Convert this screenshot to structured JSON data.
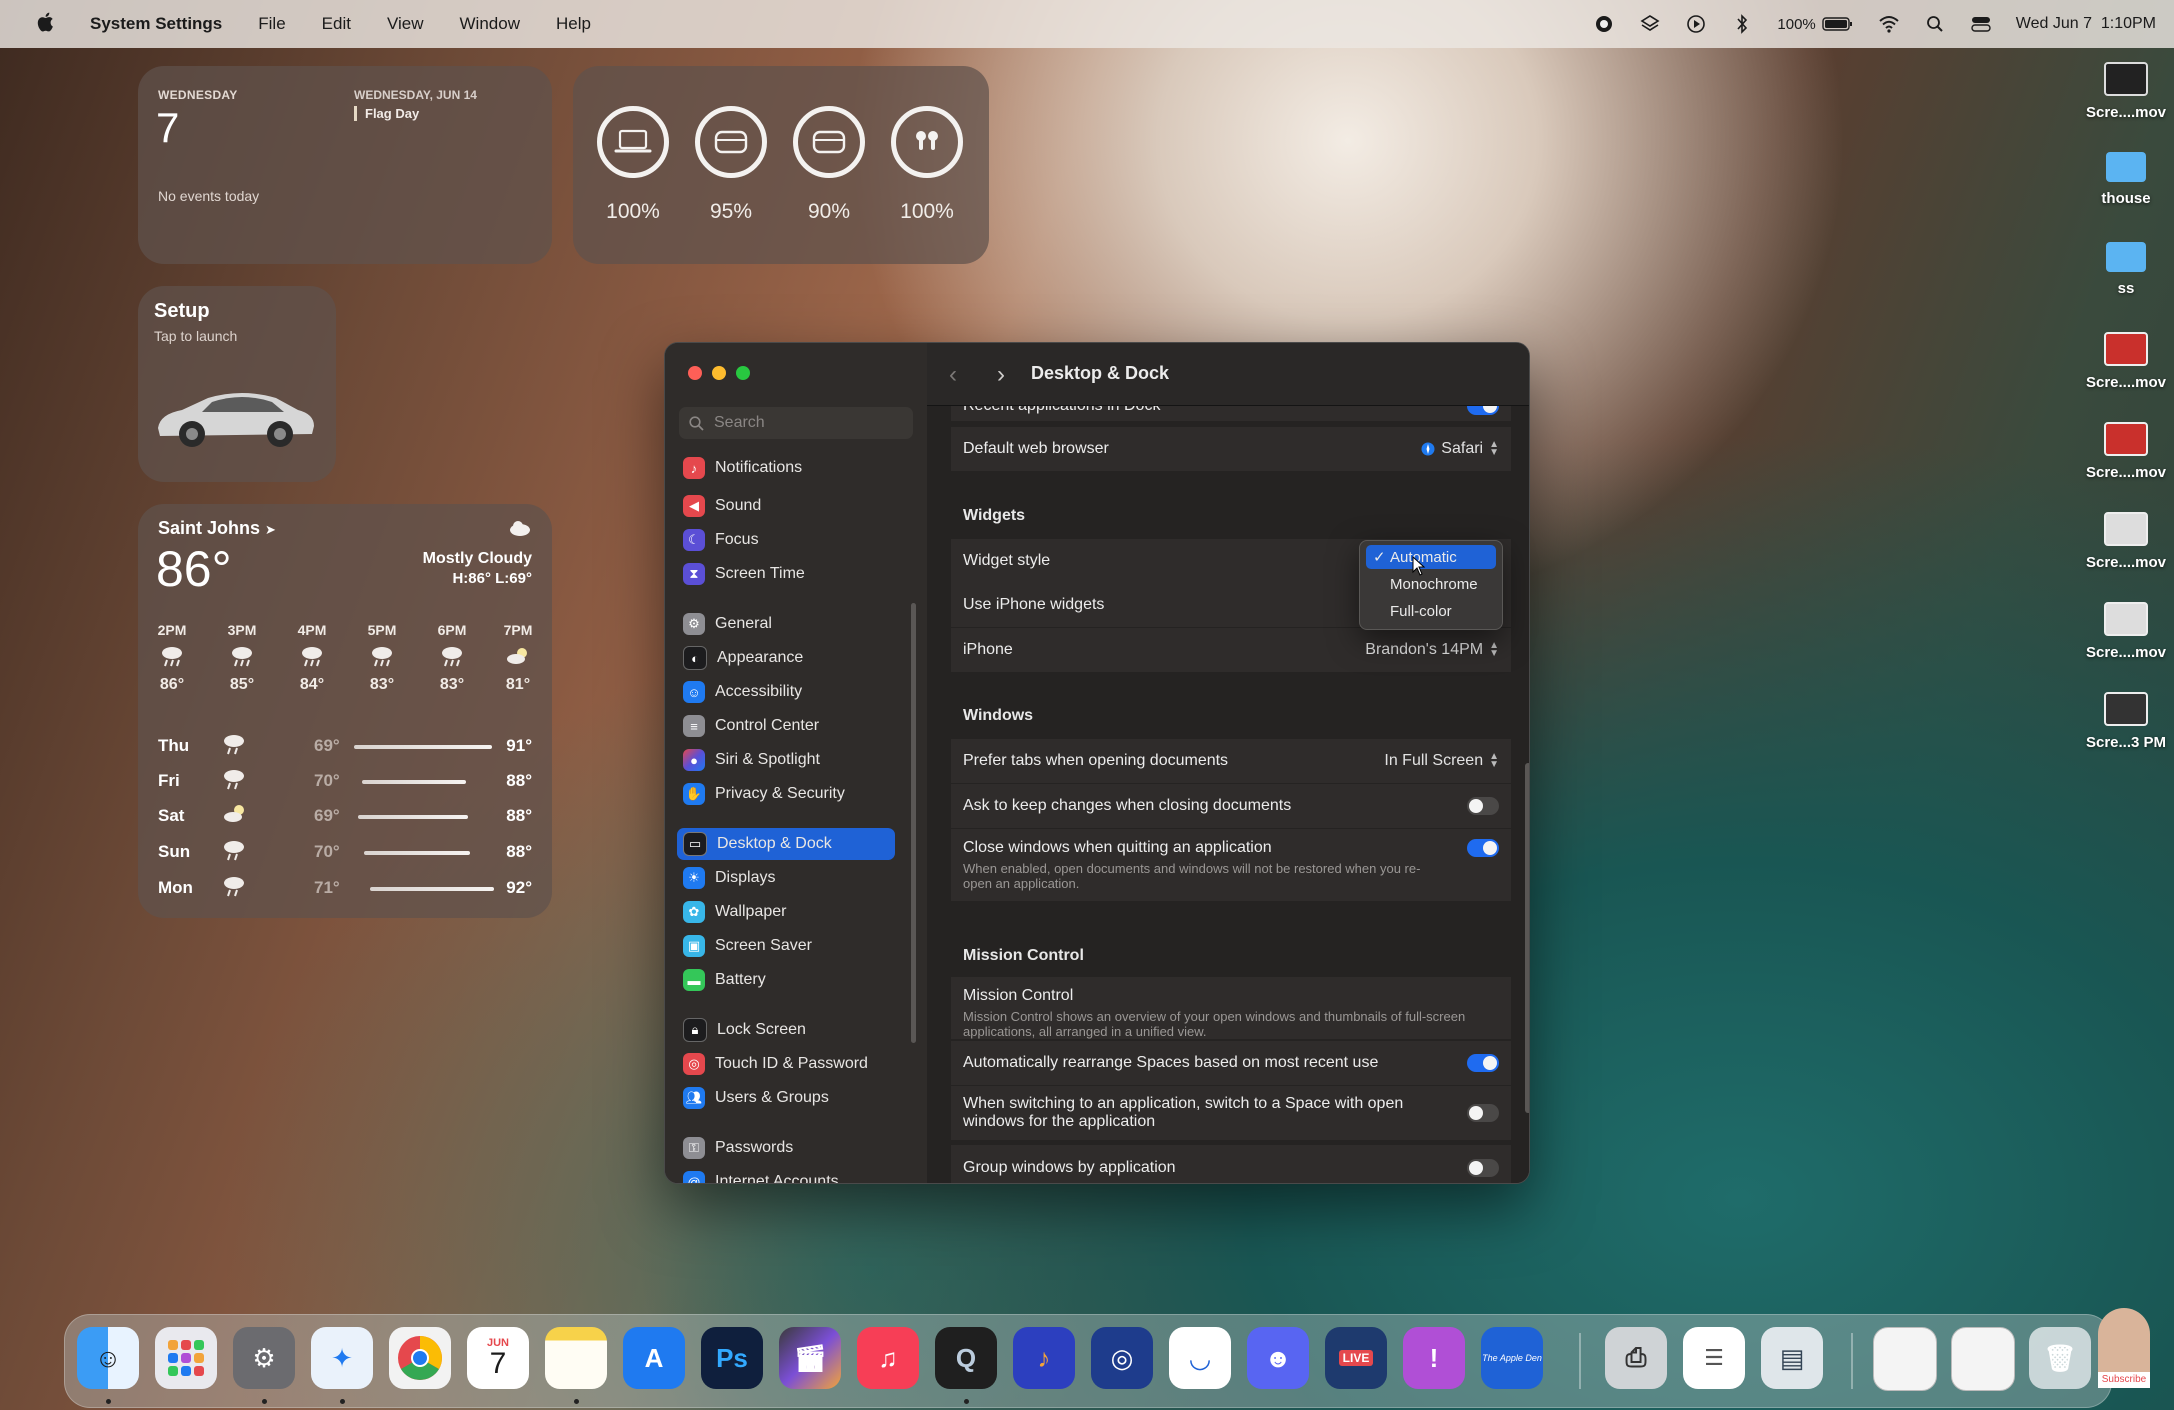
{
  "menubar": {
    "app_name": "System Settings",
    "menus": [
      "File",
      "Edit",
      "View",
      "Window",
      "Help"
    ],
    "battery": "100%",
    "datetime": "Wed Jun 7  1:10PM"
  },
  "calendar_widget": {
    "weekday": "WEDNESDAY",
    "day": "7",
    "no_events": "No events today",
    "upcoming_date": "WEDNESDAY, JUN 14",
    "upcoming_event": "Flag Day"
  },
  "batteries_widget": {
    "devices": [
      {
        "icon": "laptop-icon",
        "percent": "100%"
      },
      {
        "icon": "airpods-case-icon",
        "percent": "95%"
      },
      {
        "icon": "airpods-case-icon",
        "percent": "90%"
      },
      {
        "icon": "airpods-icon",
        "percent": "100%"
      }
    ]
  },
  "setup_widget": {
    "title": "Setup",
    "subtitle": "Tap to launch"
  },
  "weather_widget": {
    "city": "Saint Johns",
    "temp": "86°",
    "condition": "Mostly Cloudy",
    "hilo": "H:86° L:69°",
    "hourly": [
      {
        "time": "2PM",
        "temp": "86°"
      },
      {
        "time": "3PM",
        "temp": "85°"
      },
      {
        "time": "4PM",
        "temp": "84°"
      },
      {
        "time": "5PM",
        "temp": "83°"
      },
      {
        "time": "6PM",
        "temp": "83°"
      },
      {
        "time": "7PM",
        "temp": "81°"
      }
    ],
    "daily": [
      {
        "day": "Thu",
        "low": "69°",
        "high": "91°"
      },
      {
        "day": "Fri",
        "low": "70°",
        "high": "88°"
      },
      {
        "day": "Sat",
        "low": "69°",
        "high": "88°"
      },
      {
        "day": "Sun",
        "low": "70°",
        "high": "88°"
      },
      {
        "day": "Mon",
        "low": "71°",
        "high": "92°"
      }
    ]
  },
  "settings": {
    "search_placeholder": "Search",
    "header_title": "Desktop & Dock",
    "sidebar": [
      {
        "label": "Notifications",
        "color": "#e5484d",
        "icon": "bell-icon"
      },
      {
        "label": "Sound",
        "color": "#e5484d",
        "icon": "speaker-icon"
      },
      {
        "label": "Focus",
        "color": "#5b4fd6",
        "icon": "moon-icon"
      },
      {
        "label": "Screen Time",
        "color": "#5b4fd6",
        "icon": "hourglass-icon"
      },
      {
        "label": "General",
        "color": "#8e8e93",
        "icon": "gear-icon"
      },
      {
        "label": "Appearance",
        "color": "#1c1c1e",
        "icon": "appearance-icon"
      },
      {
        "label": "Accessibility",
        "color": "#1f7af0",
        "icon": "accessibility-icon"
      },
      {
        "label": "Control Center",
        "color": "#8e8e93",
        "icon": "control-center-icon"
      },
      {
        "label": "Siri & Spotlight",
        "color": "#b04fd6",
        "icon": "siri-icon"
      },
      {
        "label": "Privacy & Security",
        "color": "#1f7af0",
        "icon": "hand-icon"
      },
      {
        "label": "Desktop & Dock",
        "color": "#1c1c1e",
        "icon": "dock-icon"
      },
      {
        "label": "Displays",
        "color": "#1f7af0",
        "icon": "sun-icon"
      },
      {
        "label": "Wallpaper",
        "color": "#38b6e8",
        "icon": "wallpaper-icon"
      },
      {
        "label": "Screen Saver",
        "color": "#38b6e8",
        "icon": "screensaver-icon"
      },
      {
        "label": "Battery",
        "color": "#34c759",
        "icon": "battery-icon"
      },
      {
        "label": "Lock Screen",
        "color": "#1c1c1e",
        "icon": "lock-icon"
      },
      {
        "label": "Touch ID & Password",
        "color": "#e5484d",
        "icon": "fingerprint-icon"
      },
      {
        "label": "Users & Groups",
        "color": "#1f7af0",
        "icon": "users-icon"
      },
      {
        "label": "Passwords",
        "color": "#8e8e93",
        "icon": "key-icon"
      },
      {
        "label": "Internet Accounts",
        "color": "#1f7af0",
        "icon": "at-icon"
      }
    ],
    "top_row_partial": "Recent applications in Dock",
    "default_browser_label": "Default web browser",
    "default_browser_value": "Safari",
    "widgets_header": "Widgets",
    "widget_style_label": "Widget style",
    "use_iphone_widgets_label": "Use iPhone widgets",
    "iphone_label": "iPhone",
    "iphone_value": "Brandon's 14PM",
    "windows_header": "Windows",
    "prefer_tabs_label": "Prefer tabs when opening documents",
    "prefer_tabs_value": "In Full Screen",
    "ask_keep_changes_label": "Ask to keep changes when closing documents",
    "ask_keep_changes_on": false,
    "close_windows_label": "Close windows when quitting an application",
    "close_windows_note": "When enabled, open documents and windows will not be restored when you re-open an application.",
    "close_windows_on": true,
    "mission_control_header": "Mission Control",
    "mission_control_label": "Mission Control",
    "mission_control_note": "Mission Control shows an overview of your open windows and thumbnails of full-screen applications, all arranged in a unified view.",
    "auto_rearrange_label": "Automatically rearrange Spaces based on most recent use",
    "auto_rearrange_on": true,
    "switch_space_label": "When switching to an application, switch to a Space with open windows for the application",
    "switch_space_on": false,
    "bottom_row_partial": "Group windows by application"
  },
  "widget_style_menu": {
    "options": [
      "Automatic",
      "Monochrome",
      "Full-color"
    ],
    "selected": "Automatic"
  },
  "desktop_icons": [
    {
      "label": "Scre....mov",
      "icon": "video-file-icon"
    },
    {
      "label": "thouse",
      "icon": "folder-icon"
    },
    {
      "label": "ss",
      "icon": "folder-icon"
    },
    {
      "label": "Scre....mov",
      "icon": "video-file-icon"
    },
    {
      "label": "Scre....mov",
      "icon": "video-file-icon"
    },
    {
      "label": "Scre....mov",
      "icon": "video-file-icon"
    },
    {
      "label": "Scre....mov",
      "icon": "video-file-icon"
    },
    {
      "label": "Scre...3 PM",
      "icon": "screenshot-file-icon"
    }
  ],
  "dock": {
    "calendar_month": "JUN",
    "calendar_day": "7",
    "photoshop_label": "Ps",
    "live_badge": "LIVE",
    "apple_den_label": "The Apple Den",
    "subscribe_label": "Subscribe"
  }
}
